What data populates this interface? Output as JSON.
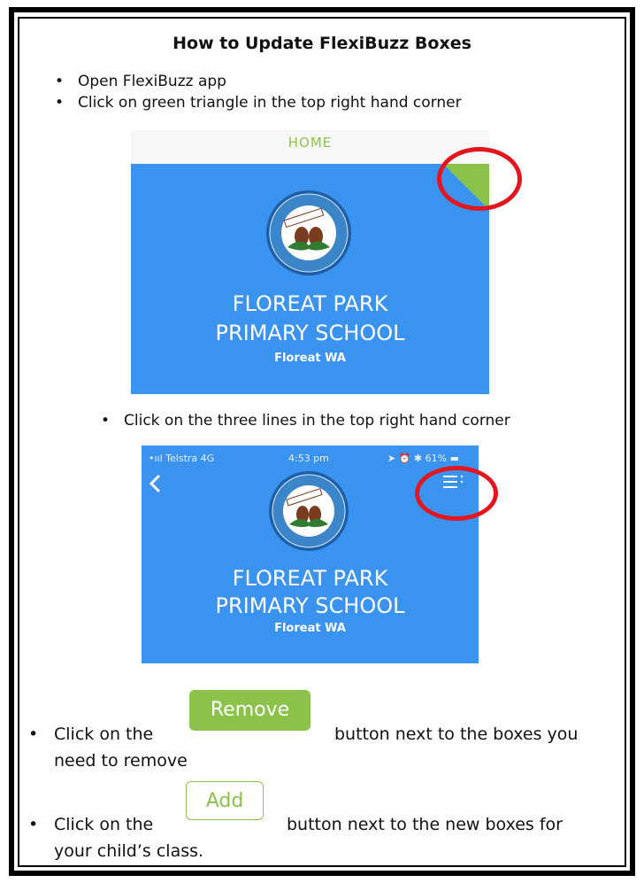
{
  "title": "How to Update FlexiBuzz Boxes",
  "steps": {
    "open_app": "Open FlexiBuzz app",
    "click_triangle": "Click on green triangle in the top right hand corner",
    "click_lines": "Click on the three lines in the top right hand corner"
  },
  "screen1": {
    "home_label": "HOME",
    "school_line1": "FLOREAT PARK",
    "school_line2": "PRIMARY SCHOOL",
    "location": "Floreat WA",
    "logo_top_text": "FLOREAT PARK",
    "logo_bottom_text": "PRIMARY SCHOOL",
    "colors": {
      "background": "#3a93ef",
      "triangle": "#8bc34a",
      "highlight_ring": "#e4151e"
    }
  },
  "screen2": {
    "carrier": "Telstra",
    "network": "4G",
    "time": "4:53 pm",
    "battery": "61%",
    "school_line1": "FLOREAT PARK",
    "school_line2": "PRIMARY SCHOOL",
    "location": "Floreat WA"
  },
  "remove_step": {
    "prefix": "Click on the",
    "button_label": "Remove",
    "suffix_line1": "button next to the boxes you",
    "suffix_line2": "need to remove"
  },
  "add_step": {
    "prefix": "Click on the",
    "button_label": "Add",
    "suffix_line1": "button next to the new boxes for",
    "suffix_line2": "your child’s class."
  },
  "bullet_char": "•"
}
